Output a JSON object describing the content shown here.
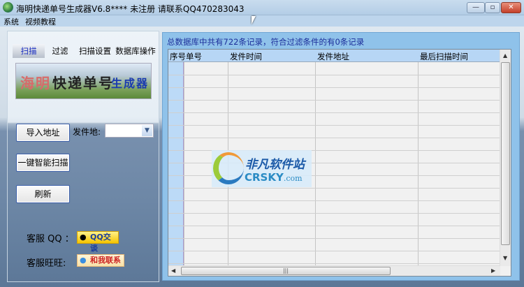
{
  "window": {
    "title": "海明快递单号生成器V6.8****   未注册 请联系QQ470283043",
    "minimize": "—",
    "maximize": "▫",
    "close": "✕"
  },
  "menu": [
    "系统",
    "视频教程"
  ],
  "tabs": [
    {
      "label": "扫描",
      "active": true
    },
    {
      "label": "过滤"
    },
    {
      "label": "扫描设置"
    },
    {
      "label": "数据库操作"
    }
  ],
  "banner": {
    "text_red": "海明",
    "text_black": "快递单号",
    "text_blue": "生成器"
  },
  "controls": {
    "import_button": "导入地址",
    "origin_label": "发件地:",
    "origin_value": "",
    "scan_button": "一键智能扫描",
    "refresh_button": "刷新"
  },
  "support": {
    "qq_label": "客服 QQ ：",
    "qq_button": "QQ交谈",
    "ww_label": "客服旺旺:",
    "ww_button": "和我联系"
  },
  "info": "总数据库中共有722条记录，符合过滤条件的有0条记录",
  "table": {
    "columns": [
      "序号",
      "单号",
      "发件时间",
      "发件地址",
      "最后扫描时间"
    ],
    "rows": []
  },
  "watermark": {
    "cn": "非凡软件站",
    "en": "CRSKY",
    "en_suffix": ".com"
  },
  "colors": {
    "panel": "#8fc2ea",
    "header": "#b7d6f5",
    "info_text": "#1c2e9a"
  }
}
